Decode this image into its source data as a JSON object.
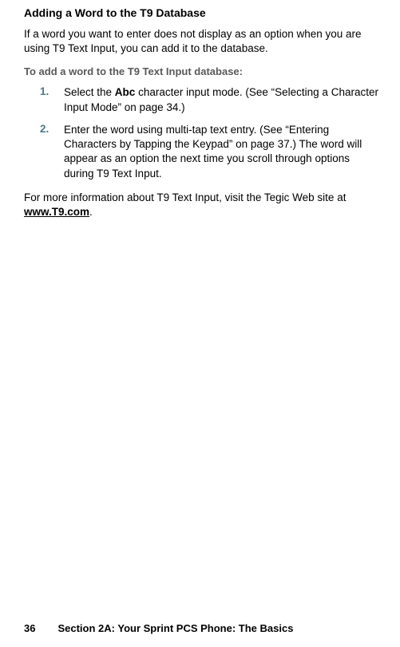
{
  "heading": "Adding a Word to the T9 Database",
  "intro": "If a word you want to enter does not display as an option when you are using T9 Text Input, you can add it to the database.",
  "subHeading": "To add a word to the T9 Text Input database:",
  "steps": [
    {
      "num": "1.",
      "pre": "Select the ",
      "bold": "Abc",
      "post": " character input mode. (See “Selecting a Character Input Mode” on page 34.)"
    },
    {
      "num": "2.",
      "pre": "Enter the word using multi-tap text entry. (See “Entering Characters by Tapping the Keypad” on page 37.) The word will appear as an option the next time you scroll through options during T9 Text Input.",
      "bold": "",
      "post": ""
    }
  ],
  "closingPre": "For more information about T9 Text Input, visit the Tegic Web site at ",
  "closingLink": "www.T9.com",
  "closingPost": ".",
  "pageNum": "36",
  "footerTitle": "Section 2A: Your Sprint PCS Phone: The Basics"
}
